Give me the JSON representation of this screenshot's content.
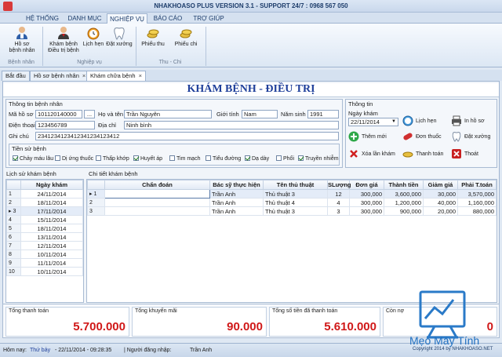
{
  "window": {
    "title": "NHAKHOASO PLUS VERSION 3.1 - SUPPORT 24/7 : 0968 567 050"
  },
  "menu_tabs": [
    "HỆ THỐNG",
    "DANH MỤC",
    "NGHIỆP VỤ",
    "BÁO CÁO",
    "TRỢ GIÚP"
  ],
  "ribbon": {
    "groups": [
      "Bệnh nhân",
      "Nghiệp vụ",
      "Thu - Chi"
    ],
    "buttons": {
      "ho_so": "Hồ sơ\nbệnh nhân",
      "kham": "Khám bệnh\nĐiều trị bệnh",
      "lich_hen": "Lịch hẹn",
      "dat_xuong": "Đặt xưởng",
      "phieu_thu": "Phiếu thu",
      "phieu_chi": "Phiếu chi"
    }
  },
  "doc_tabs": [
    "Bắt đầu",
    "Hồ sơ bệnh nhân",
    "Khám chữa bệnh"
  ],
  "page_title": "KHÁM BỆNH - ĐIỀU TRỊ",
  "patient": {
    "section": "Thông tin bệnh nhân",
    "labels": {
      "ma": "Mã hồ sơ",
      "ho_ten": "Họ và tên",
      "gioi_tinh": "Giới tính",
      "nam_sinh": "Năm sinh",
      "dien_thoai": "Điện thoại",
      "dia_chi": "Địa chỉ",
      "ghi_chu": "Ghi chú"
    },
    "ma": "101120140000",
    "browse": "...",
    "ho_ten": "Trần Nguyên",
    "gioi_tinh": "Nam",
    "nam_sinh": "1991",
    "dien_thoai": "123456789",
    "dia_chi": "Ninh bình",
    "ghi_chu": "2341234123412341234123412"
  },
  "history": {
    "section": "Tiền sử bệnh",
    "items": [
      {
        "label": "Chảy máu lâu",
        "checked": true
      },
      {
        "label": "Dị ứng thuốc",
        "checked": false
      },
      {
        "label": "Thấp khớp",
        "checked": false
      },
      {
        "label": "Huyết áp",
        "checked": true
      },
      {
        "label": "Tim mạch",
        "checked": false
      },
      {
        "label": "Tiểu đường",
        "checked": false
      },
      {
        "label": "Dạ dày",
        "checked": true
      },
      {
        "label": "Phổi",
        "checked": false
      },
      {
        "label": "Truyền nhiễm",
        "checked": true
      }
    ]
  },
  "info": {
    "section": "Thông tin",
    "date_label": "Ngày khám",
    "date": "22/11/2014",
    "actions": {
      "lich_hen": "Lịch hẹn",
      "in_ho_so": "In hồ sơ",
      "them_moi": "Thêm mới",
      "don_thuoc": "Đơn thuốc",
      "dat_xuong": "Đặt xưởng",
      "xoa": "Xóa lần khám",
      "thanh_toan": "Thanh toán",
      "thoat": "Thoát"
    }
  },
  "visit_history": {
    "section": "Lịch sử khám bệnh",
    "header": "Ngày khám",
    "rows": [
      {
        "no": "1",
        "date": "24/11/2014"
      },
      {
        "no": "2",
        "date": "18/11/2014"
      },
      {
        "no": "3",
        "date": "17/11/2014",
        "marker": "▸"
      },
      {
        "no": "4",
        "date": "15/11/2014"
      },
      {
        "no": "5",
        "date": "18/11/2014"
      },
      {
        "no": "6",
        "date": "13/11/2014"
      },
      {
        "no": "7",
        "date": "12/11/2014"
      },
      {
        "no": "8",
        "date": "10/11/2014"
      },
      {
        "no": "9",
        "date": "11/11/2014"
      },
      {
        "no": "10",
        "date": "10/11/2014"
      }
    ]
  },
  "details": {
    "section": "Chi tiết khám bệnh",
    "headers": [
      "Chẩn đoán",
      "Bác sỹ thực hiện",
      "Tên thủ thuật",
      "SLượng",
      "Đơn giá",
      "Thành tiền",
      "Giảm giá",
      "Phải T.toán"
    ],
    "rows": [
      {
        "marker": "▸",
        "no": "1",
        "chan_doan": "",
        "bac_sy": "Trần Anh",
        "thu_thuat": "Thủ thuật 3",
        "sl": "12",
        "don_gia": "300,000",
        "thanh_tien": "3,600,000",
        "giam_gia": "30,000",
        "phai_tt": "3,570,000"
      },
      {
        "marker": "",
        "no": "2",
        "chan_doan": "",
        "bac_sy": "Trần Anh",
        "thu_thuat": "Thủ thuật 4",
        "sl": "4",
        "don_gia": "300,000",
        "thanh_tien": "1,200,000",
        "giam_gia": "40,000",
        "phai_tt": "1,160,000"
      },
      {
        "marker": "",
        "no": "3",
        "chan_doan": "",
        "bac_sy": "Trần Anh",
        "thu_thuat": "Thủ thuật 3",
        "sl": "3",
        "don_gia": "300,000",
        "thanh_tien": "900,000",
        "giam_gia": "20,000",
        "phai_tt": "880,000"
      }
    ]
  },
  "totals": {
    "tong_thanh_toan_label": "Tổng thanh toán",
    "tong_thanh_toan": "5.700.000",
    "khuyen_mai_label": "Tổng khuyến mãi",
    "khuyen_mai": "90.000",
    "da_thanh_toan_label": "Tổng số tiền đã thanh toán",
    "da_thanh_toan": "5.610.000",
    "con_no_label": "Còn nợ",
    "con_no": "0"
  },
  "status": {
    "today_label": "Hôm nay:",
    "weekday": "Thứ bảy",
    "date_time": "- 22/11/2014 - 09:28:35",
    "user_label": "| Người đăng nhập:",
    "user": "Trần Anh"
  },
  "watermark": {
    "brand": "Mẹo Máy Tính",
    "copyright": "Copyright 2014 by NHAKHOASO.NET"
  },
  "colors": {
    "title_blue": "#1f3f9a",
    "total_red": "#d01818",
    "accent": "#1d3d6b"
  }
}
